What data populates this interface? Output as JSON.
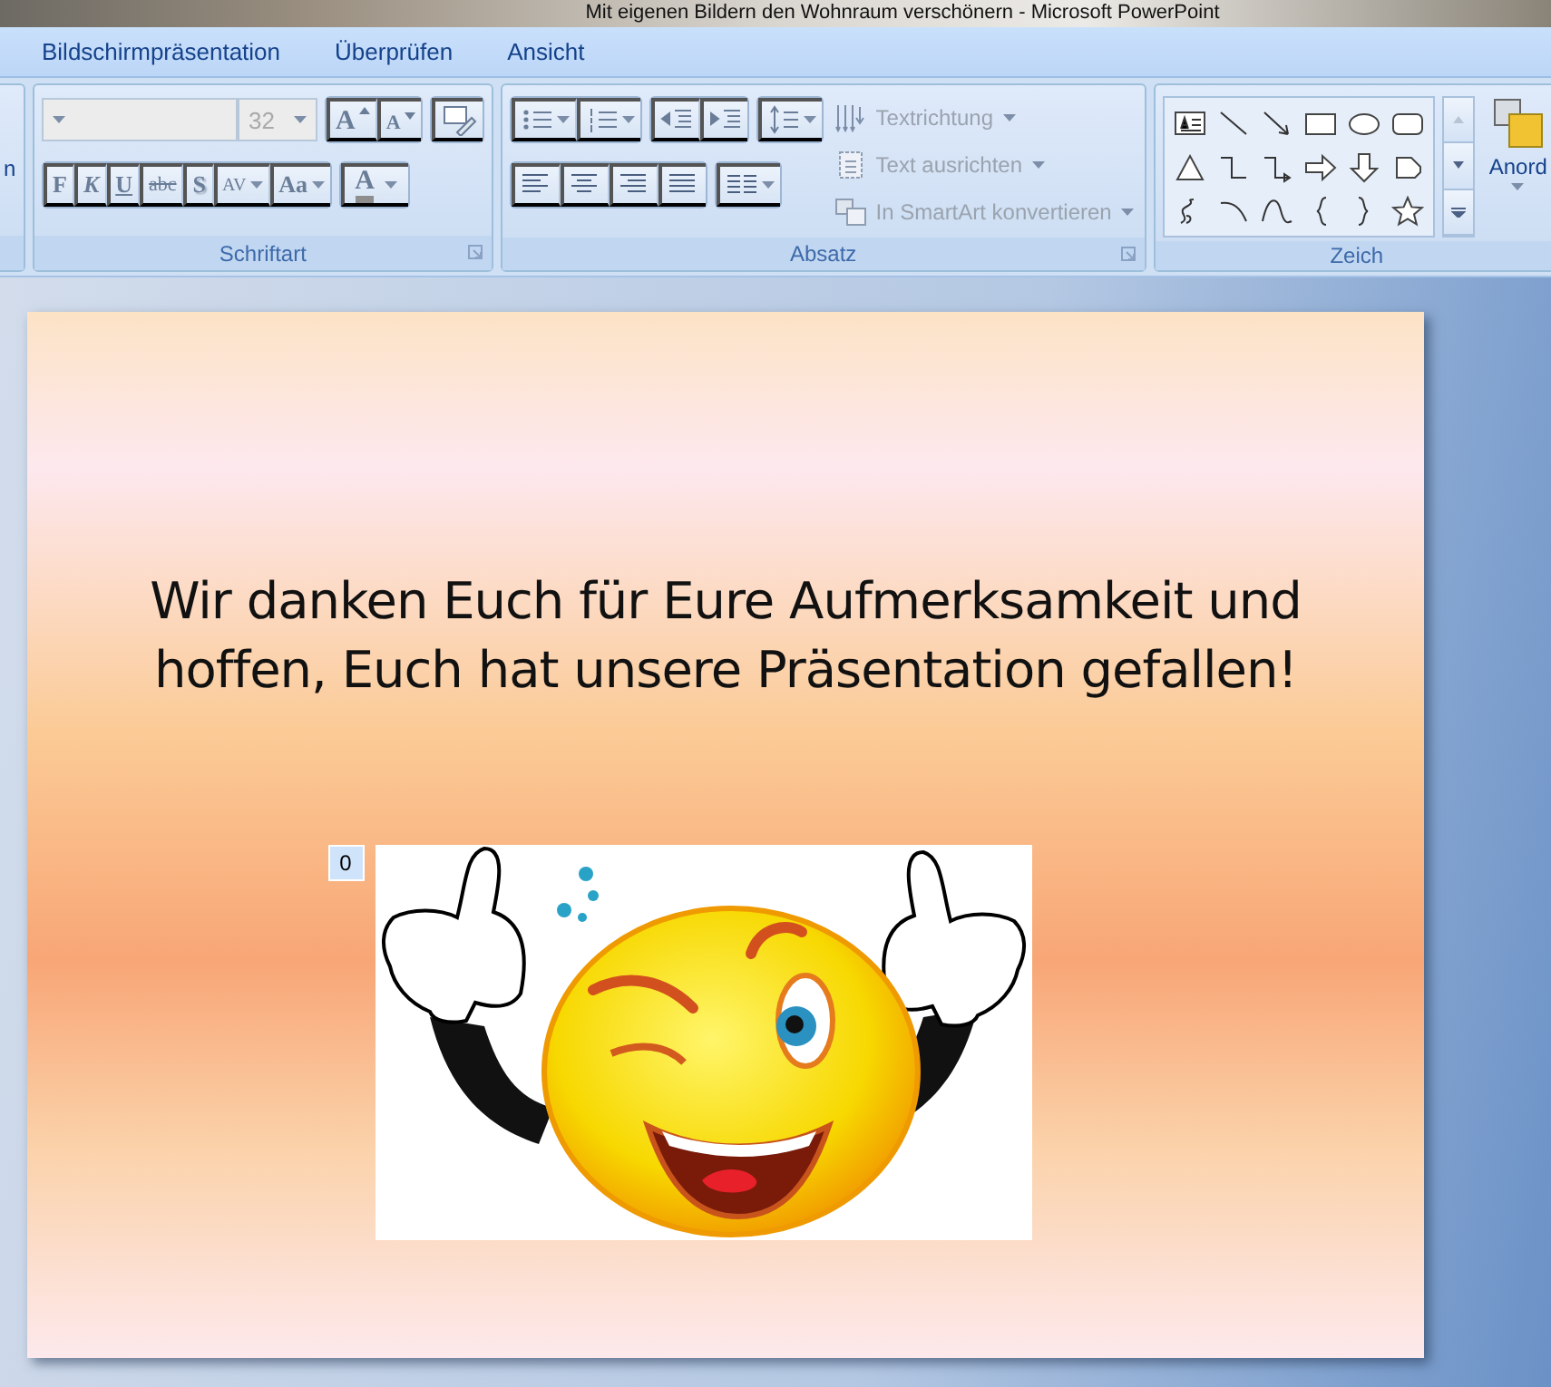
{
  "window": {
    "title": "Mit eigenen Bildern den Wohnraum verschönern - Microsoft PowerPoint"
  },
  "tabs": [
    {
      "label": "Bildschirmpräsentation",
      "selected": false
    },
    {
      "label": "Überprüfen",
      "selected": false
    },
    {
      "label": "Ansicht",
      "selected": false
    }
  ],
  "ribbon": {
    "cut_group": {
      "button_label": "n"
    },
    "font_group": {
      "title": "Schriftart",
      "font_size": "32",
      "grow_font": {
        "label": "A"
      },
      "shrink_font": {
        "label": "A"
      },
      "format_buttons": [
        {
          "label": "F",
          "kind": "bold"
        },
        {
          "label": "K",
          "kind": "italic"
        },
        {
          "label": "U",
          "kind": "underline"
        },
        {
          "label": "abc",
          "kind": "strike"
        },
        {
          "label": "S",
          "kind": "shadow"
        },
        {
          "label": "AV",
          "kind": "spacing"
        },
        {
          "label": "Aa",
          "kind": "case"
        }
      ],
      "color_button": {
        "label": "A"
      }
    },
    "paragraph_group": {
      "title": "Absatz",
      "commands": [
        {
          "label": "Textrichtung",
          "disabled": true
        },
        {
          "label": "Text ausrichten",
          "disabled": true
        },
        {
          "label": "In SmartArt konvertieren",
          "disabled": true
        }
      ]
    },
    "drawing_group": {
      "title": "Zeich",
      "arrange_label": "Anord"
    }
  },
  "slide": {
    "title": "Wir danken Euch für Eure Aufmerksamkeit und hoffen, Euch hat unsere Präsentation gefallen!",
    "animation_tag": "0"
  }
}
